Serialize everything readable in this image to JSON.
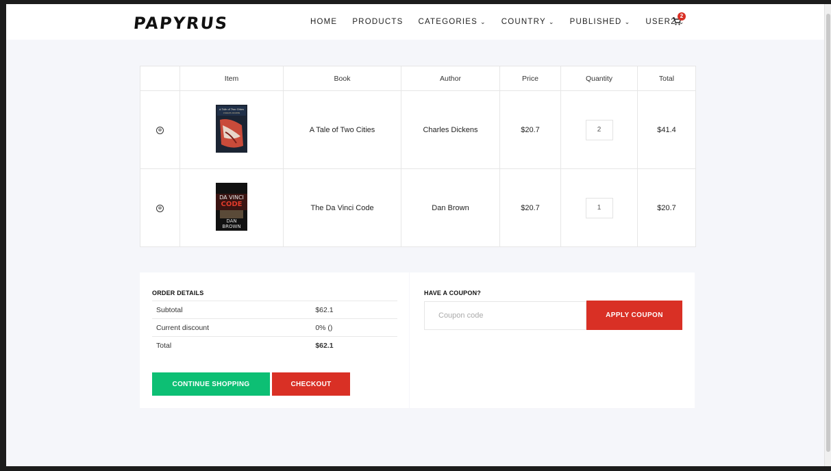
{
  "brand": {
    "logo_text": "PAPYRUS"
  },
  "nav": {
    "items": [
      {
        "label": "HOME",
        "dropdown": false
      },
      {
        "label": "PRODUCTS",
        "dropdown": false
      },
      {
        "label": "CATEGORIES",
        "dropdown": true
      },
      {
        "label": "COUNTRY",
        "dropdown": true
      },
      {
        "label": "PUBLISHED",
        "dropdown": true
      },
      {
        "label": "USER2",
        "dropdown": true
      }
    ],
    "cart_count": "2",
    "chevron": "⌄"
  },
  "cart": {
    "headers": [
      "",
      "Item",
      "Book",
      "Author",
      "Price",
      "Quantity",
      "Total"
    ],
    "rows": [
      {
        "book": "A Tale of Two Cities",
        "author": "Charles Dickens",
        "price": "$20.7",
        "quantity": "2",
        "total": "$41.4",
        "remove_icon": "⊗"
      },
      {
        "book": "The Da Vinci Code",
        "author": "Dan Brown",
        "price": "$20.7",
        "quantity": "1",
        "total": "$20.7",
        "remove_icon": "⊗"
      }
    ],
    "covers": [
      {
        "lines": [
          "A Tale of Two Cities",
          "CHARLES DICKENS"
        ]
      },
      {
        "lines": [
          "DA VINCI",
          "CODE",
          "DAN",
          "BROWN"
        ]
      }
    ]
  },
  "order": {
    "title": "ORDER DETAILS",
    "subtotal_label": "Subtotal",
    "subtotal_value": "$62.1",
    "discount_label": "Current discount",
    "discount_value": "0% ()",
    "total_label": "Total",
    "total_value": "$62.1",
    "continue_label": "CONTINUE SHOPPING",
    "checkout_label": "CHECKOUT"
  },
  "coupon": {
    "title": "HAVE A COUPON?",
    "placeholder": "Coupon code",
    "apply_label": "APPLY COUPON"
  },
  "colors": {
    "accent_red": "#d93025",
    "accent_green": "#0dbf74",
    "page_bg": "#f5f6fa"
  }
}
